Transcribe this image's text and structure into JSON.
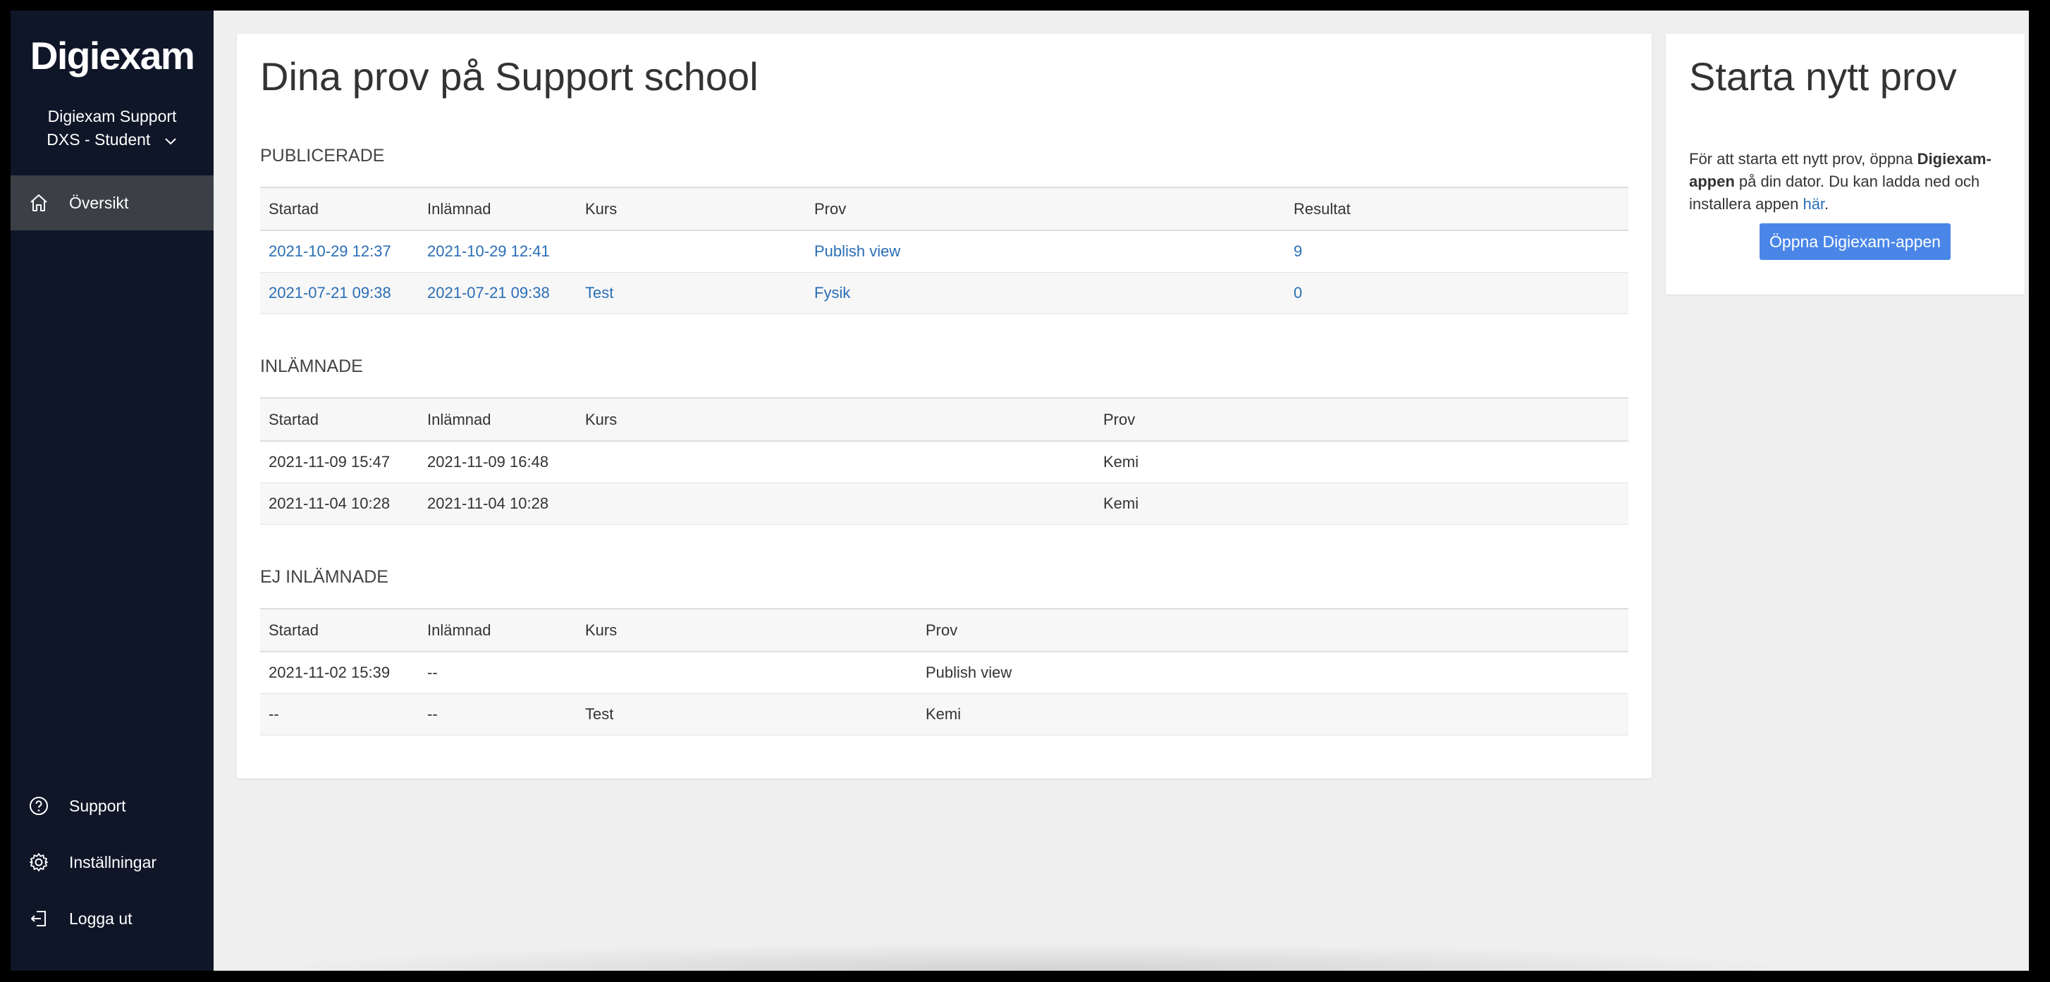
{
  "sidebar": {
    "logo": "Digiexam",
    "org_name": "Digiexam Support",
    "role": "DXS - Student",
    "nav": {
      "overview": "Översikt",
      "support": "Support",
      "settings": "Inställningar",
      "logout": "Logga ut"
    }
  },
  "main": {
    "title": "Dina prov på Support school",
    "published": {
      "heading": "PUBLICERADE",
      "columns": [
        "Startad",
        "Inlämnad",
        "Kurs",
        "Prov",
        "Resultat"
      ],
      "rows": [
        {
          "started": "2021-10-29 12:37",
          "submitted": "2021-10-29 12:41",
          "course": "",
          "exam": "Publish view",
          "result": "9"
        },
        {
          "started": "2021-07-21 09:38",
          "submitted": "2021-07-21 09:38",
          "course": "Test",
          "exam": "Fysik",
          "result": "0"
        }
      ]
    },
    "submitted": {
      "heading": "INLÄMNADE",
      "columns": [
        "Startad",
        "Inlämnad",
        "Kurs",
        "Prov"
      ],
      "rows": [
        {
          "started": "2021-11-09 15:47",
          "submitted": "2021-11-09 16:48",
          "course": "",
          "exam": "Kemi"
        },
        {
          "started": "2021-11-04 10:28",
          "submitted": "2021-11-04 10:28",
          "course": "",
          "exam": "Kemi"
        }
      ]
    },
    "not_submitted": {
      "heading": "EJ INLÄMNADE",
      "columns": [
        "Startad",
        "Inlämnad",
        "Kurs",
        "Prov"
      ],
      "rows": [
        {
          "started": "2021-11-02 15:39",
          "submitted": "--",
          "course": "",
          "exam": "Publish view"
        },
        {
          "started": "--",
          "submitted": "--",
          "course": "Test",
          "exam": "Kemi"
        }
      ]
    }
  },
  "side": {
    "title": "Starta nytt prov",
    "text_before": "För att starta ett nytt prov, öppna ",
    "text_bold": "Digiexam-appen",
    "text_middle": " på din dator. Du kan ladda ned och installera appen ",
    "link_text": "här",
    "text_after": ".",
    "button_label": "Öppna Digiexam-appen"
  },
  "colors": {
    "sidebar_bg": "#0e1628",
    "active_nav_bg": "#3c3f45",
    "link": "#2a6eb5",
    "button": "#4a86e8"
  }
}
